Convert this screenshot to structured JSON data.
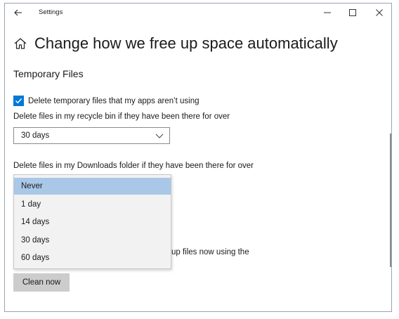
{
  "window": {
    "title": "Settings",
    "back_icon": "arrow-left-icon",
    "minimize_icon": "minimize-icon",
    "maximize_icon": "maximize-icon",
    "close_icon": "close-icon"
  },
  "header": {
    "icon": "home-icon",
    "title": "Change how we free up space automatically"
  },
  "temporary_files": {
    "section_title": "Temporary Files",
    "checkbox_label": "Delete temporary files that my apps aren’t using",
    "checkbox_checked": true,
    "recycle_label": "Delete files in my recycle bin if they have been there for over",
    "recycle_value": "30 days",
    "downloads_label": "Delete files in my Downloads folder if they have been there for over",
    "downloads_options": [
      "Never",
      "1 day",
      "14 days",
      "30 days",
      "60 days"
    ],
    "downloads_selected": "Never"
  },
  "partial_text": "up files now using the",
  "clean_button_label": "Clean now",
  "colors": {
    "accent": "#0078d7",
    "selected_option": "#a9c8e8",
    "button_bg": "#cccccc"
  }
}
